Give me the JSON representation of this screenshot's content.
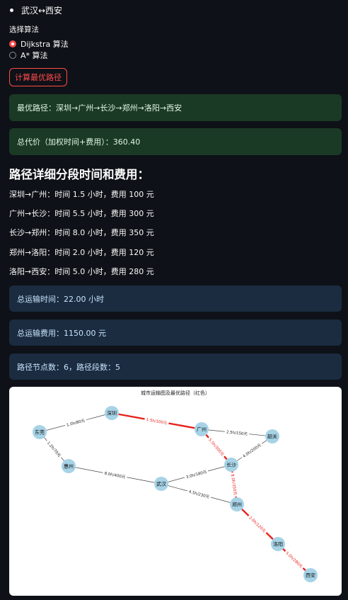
{
  "route_item": "武汉↔西安",
  "algo": {
    "label": "选择算法",
    "options": [
      {
        "label": "Dijkstra 算法",
        "selected": true
      },
      {
        "label": "A* 算法",
        "selected": false
      }
    ]
  },
  "button": {
    "label": "计算最优路径"
  },
  "results": {
    "best_path": "最优路径：深圳→广州→长沙→郑州→洛阳→西安",
    "total_cost": "总代价（加权时间+费用）：360.40"
  },
  "details": {
    "heading": "路径详细分段时间和费用：",
    "segments": [
      "深圳→广州：时间 1.5 小时，费用 100 元",
      "广州→长沙：时间 5.5 小时，费用 300 元",
      "长沙→郑州：时间 8.0 小时，费用 350 元",
      "郑州→洛阳：时间 2.0 小时，费用 120 元",
      "洛阳→西安：时间 5.0 小时，费用 280 元"
    ]
  },
  "summary": {
    "total_time": "总运输时间：22.00 小时",
    "total_fee": "总运输费用：1150.00 元",
    "counts": "路径节点数：6，路径段数：5"
  },
  "graph": {
    "title": "城市运输图及最优路径（红色）",
    "node_color": "#a7d3e6",
    "highlight_color": "#e8201a",
    "edge_color": "#444444",
    "nodes": [
      "东莞",
      "深圳",
      "广州",
      "韶关",
      "惠州",
      "长沙",
      "武汉",
      "郑州",
      "洛阳",
      "西安"
    ],
    "edges": [
      {
        "from": "东莞",
        "to": "深圳",
        "label": "1.0h/80元",
        "highlight": false
      },
      {
        "from": "东莞",
        "to": "惠州",
        "label": "1.2h/70元",
        "highlight": false
      },
      {
        "from": "深圳",
        "to": "广州",
        "label": "1.5h/100元",
        "highlight": true
      },
      {
        "from": "广州",
        "to": "韶关",
        "label": "2.5h/150元",
        "highlight": false
      },
      {
        "from": "广州",
        "to": "长沙",
        "label": "5.5h/300元",
        "highlight": true
      },
      {
        "from": "韶关",
        "to": "长沙",
        "label": "4.0h/200元",
        "highlight": false
      },
      {
        "from": "惠州",
        "to": "武汉",
        "label": "8.0h/400元",
        "highlight": false
      },
      {
        "from": "武汉",
        "to": "长沙",
        "label": "3.0h/180元",
        "highlight": false
      },
      {
        "from": "武汉",
        "to": "郑州",
        "label": "4.5h/230元",
        "highlight": false
      },
      {
        "from": "长沙",
        "to": "郑州",
        "label": "8.0h/350元",
        "highlight": true
      },
      {
        "from": "郑州",
        "to": "洛阳",
        "label": "2.0h/120元",
        "highlight": true
      },
      {
        "from": "洛阳",
        "to": "西安",
        "label": "5.0h/280元",
        "highlight": true
      }
    ]
  }
}
